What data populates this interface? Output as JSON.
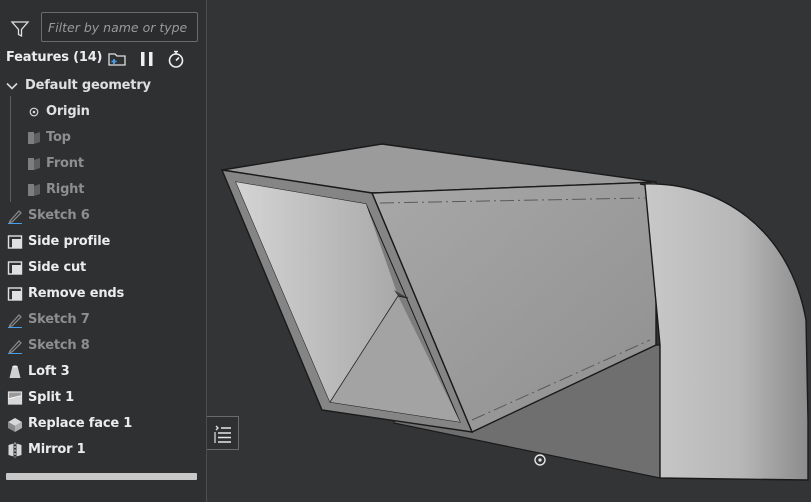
{
  "filter": {
    "placeholder": "Filter by name or type",
    "value": ""
  },
  "features": {
    "title": "Features (14)",
    "items": [
      {
        "label": "Default geometry",
        "icon": "chevron-down-icon",
        "style": "normal"
      },
      {
        "label": "Origin",
        "icon": "origin-icon",
        "style": "normal"
      },
      {
        "label": "Top",
        "icon": "plane-icon",
        "style": "dim"
      },
      {
        "label": "Front",
        "icon": "plane-icon",
        "style": "dim"
      },
      {
        "label": "Right",
        "icon": "plane-icon",
        "style": "dim"
      },
      {
        "label": "Sketch 6",
        "icon": "sketch-icon",
        "style": "dim"
      },
      {
        "label": "Side profile",
        "icon": "extrude-icon",
        "style": "bold"
      },
      {
        "label": "Side cut",
        "icon": "extrude-icon",
        "style": "bold"
      },
      {
        "label": "Remove ends",
        "icon": "extrude-icon",
        "style": "bold"
      },
      {
        "label": "Sketch 7",
        "icon": "sketch-icon",
        "style": "dim"
      },
      {
        "label": "Sketch 8",
        "icon": "sketch-icon",
        "style": "dim"
      },
      {
        "label": "Loft 3",
        "icon": "loft-icon",
        "style": "bold"
      },
      {
        "label": "Split 1",
        "icon": "split-icon",
        "style": "bold"
      },
      {
        "label": "Replace face 1",
        "icon": "replace-face-icon",
        "style": "bold"
      },
      {
        "label": "Mirror 1",
        "icon": "mirror-icon",
        "style": "bold"
      }
    ]
  },
  "colors": {
    "background": "#333436",
    "panel": "#2f3032",
    "model_face": "#9a9a9a",
    "text": "#e6e6e6",
    "dim_text": "#8d8e90"
  }
}
